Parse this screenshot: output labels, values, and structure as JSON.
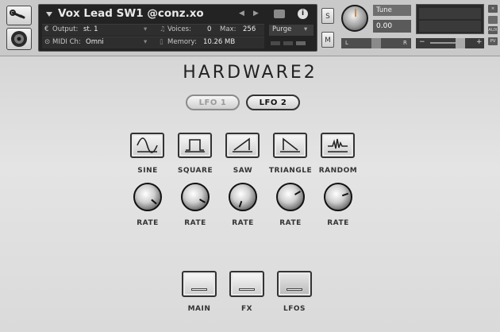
{
  "instrument": {
    "name": "Vox Lead SW1 @conz.xo",
    "output_label": "Output:",
    "output_value": "st. 1",
    "voices_label": "Voices:",
    "voices_value": "0",
    "max_label": "Max:",
    "max_value": "256",
    "purge_label": "Purge",
    "midi_label": "MIDI Ch:",
    "midi_value": "Omni",
    "memory_label": "Memory:",
    "memory_value": "10.26 MB"
  },
  "header": {
    "solo_label": "S",
    "mute_label": "M",
    "tune_label": "Tune",
    "tune_value": "0.00",
    "pan_left": "L",
    "pan_right": "R",
    "vol_minus": "−",
    "vol_plus": "+",
    "close_label": "×",
    "aux_label": "AUX",
    "pv_label": "PV"
  },
  "plugin": {
    "title": "HARDWARE2",
    "lfo_tabs": [
      {
        "label": "LFO 1",
        "active": false
      },
      {
        "label": "LFO 2",
        "active": true
      }
    ],
    "waveforms": [
      {
        "label": "SINE",
        "icon": "sine-wave-icon",
        "rate_label": "RATE",
        "rate_angle_deg": 130
      },
      {
        "label": "SQUARE",
        "icon": "square-wave-icon",
        "rate_label": "RATE",
        "rate_angle_deg": 120
      },
      {
        "label": "SAW",
        "icon": "saw-wave-icon",
        "rate_label": "RATE",
        "rate_angle_deg": 200
      },
      {
        "label": "TRIANGLE",
        "icon": "triangle-wave-icon",
        "rate_label": "RATE",
        "rate_angle_deg": 60
      },
      {
        "label": "RANDOM",
        "icon": "random-wave-icon",
        "rate_label": "RATE",
        "rate_angle_deg": 70
      }
    ],
    "nav": [
      {
        "label": "MAIN",
        "selected": false
      },
      {
        "label": "FX",
        "selected": false
      },
      {
        "label": "LFOS",
        "selected": true
      }
    ]
  },
  "colors": {
    "panel_bg": "#232323",
    "tune_knob_indicator": "#e08a1e",
    "main_bg": "#d9d9d9"
  }
}
